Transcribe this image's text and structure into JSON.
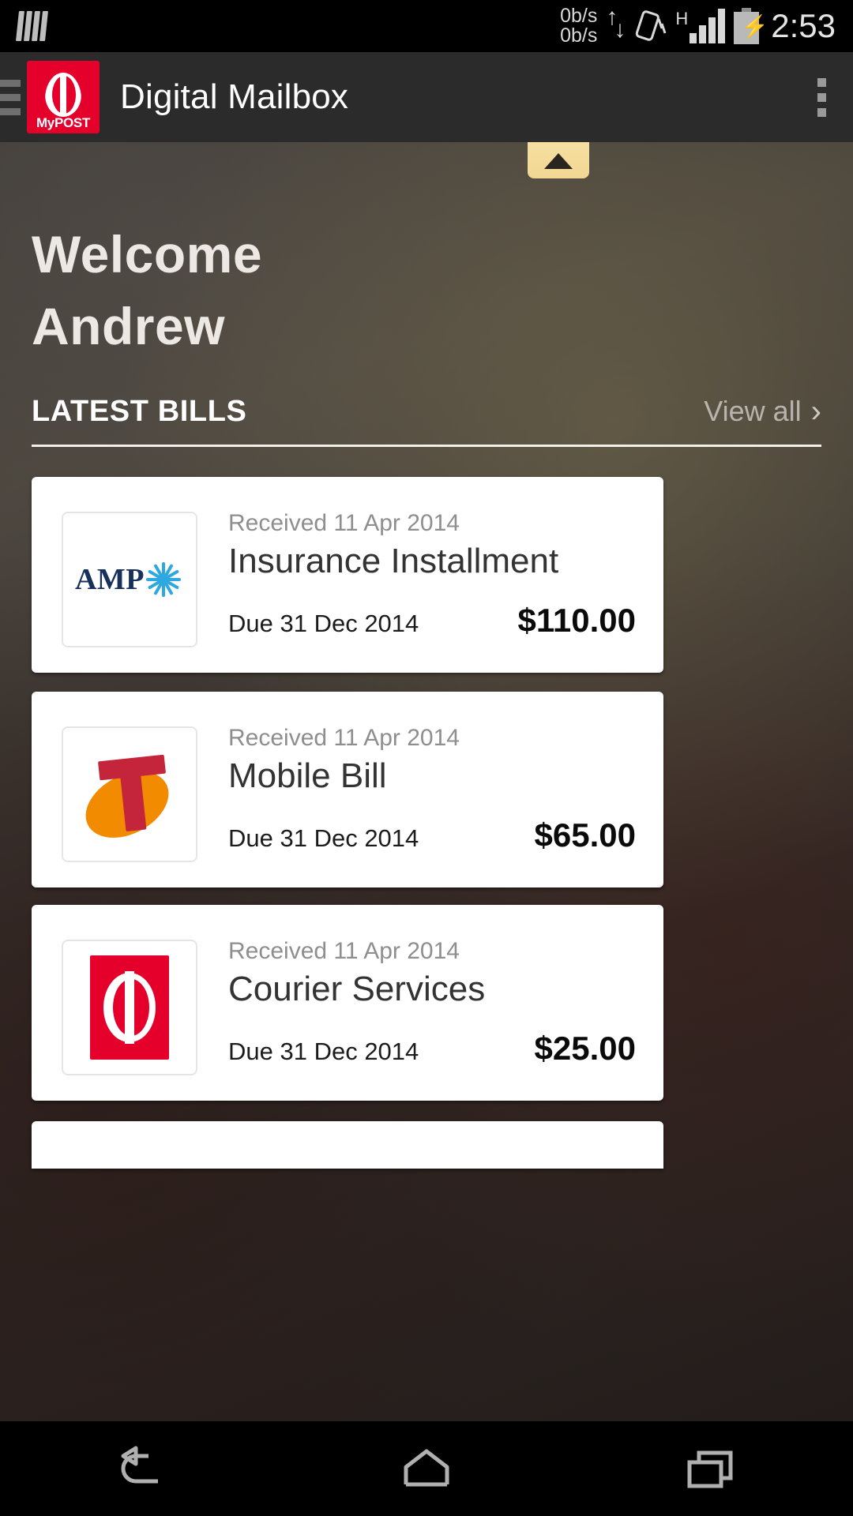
{
  "statusbar": {
    "sim_icon": "sim-card-icon",
    "net_up": "0b/s",
    "net_down": "0b/s",
    "updown_icon": "data-transfer-icon",
    "rotate_icon": "auto-rotate-icon",
    "network_type": "H",
    "signal_icon": "signal-bars-icon",
    "battery_icon": "battery-charging-icon",
    "time": "2:53"
  },
  "appbar": {
    "drawer_icon": "hamburger-menu-icon",
    "logo_text": "MyPOST",
    "title": "Digital Mailbox",
    "overflow_icon": "overflow-menu-icon"
  },
  "hero": {
    "collapse_icon": "triangle-up-icon",
    "greeting": "Welcome",
    "name": "Andrew"
  },
  "section": {
    "title": "LATEST BILLS",
    "view_all": "View all",
    "chevron": "›"
  },
  "bills": [
    {
      "logo": "amp-logo",
      "logo_text": "AMP",
      "received": "Received 11 Apr 2014",
      "name": "Insurance Installment",
      "due": "Due 31 Dec 2014",
      "amount": "$110.00"
    },
    {
      "logo": "telstra-logo",
      "logo_text": "",
      "received": "Received 11 Apr 2014",
      "name": "Mobile Bill",
      "due": "Due 31 Dec 2014",
      "amount": "$65.00"
    },
    {
      "logo": "australia-post-logo",
      "logo_text": "",
      "received": "Received 11 Apr 2014",
      "name": "Courier Services",
      "due": "Due 31 Dec 2014",
      "amount": "$25.00"
    }
  ],
  "navbar": {
    "back": "back-icon",
    "home": "home-icon",
    "recents": "recent-apps-icon"
  },
  "colors": {
    "brand_red": "#e4002b",
    "appbar_bg": "#2b2b2b",
    "card_bg": "#ffffff",
    "collapse_tab": "#f2d793",
    "amp_navy": "#17305c",
    "amp_blue": "#2ea8e0",
    "telstra_orange": "#f28b00",
    "telstra_red": "#c4253b"
  }
}
